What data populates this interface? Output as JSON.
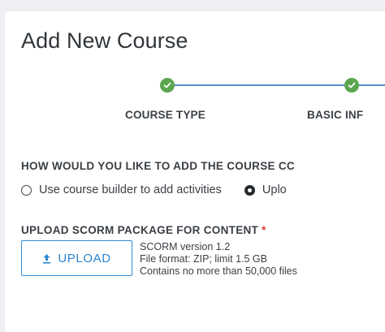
{
  "page": {
    "title": "Add New Course"
  },
  "stepper": {
    "steps": [
      {
        "label": "COURSE TYPE",
        "status": "completed"
      },
      {
        "label": "BASIC INF",
        "status": "completed"
      }
    ],
    "completed_color": "#5aa64f",
    "line_color": "#5a8bd0"
  },
  "content_method": {
    "question": "HOW WOULD YOU LIKE TO ADD THE COURSE CC",
    "options": [
      {
        "label": "Use course builder to add activities",
        "selected": false
      },
      {
        "label": "Uplo",
        "selected": true
      }
    ]
  },
  "scorm_upload": {
    "heading": "UPLOAD SCORM PACKAGE FOR CONTENT",
    "required_mark": "*",
    "button_label": "UPLOAD",
    "button_icon": "upload-arrow-icon",
    "info_lines": [
      "SCORM version 1.2",
      "File format: ZIP; limit 1.5 GB",
      "Contains no more than 50,000 files"
    ],
    "accent_color": "#2a86d2"
  }
}
